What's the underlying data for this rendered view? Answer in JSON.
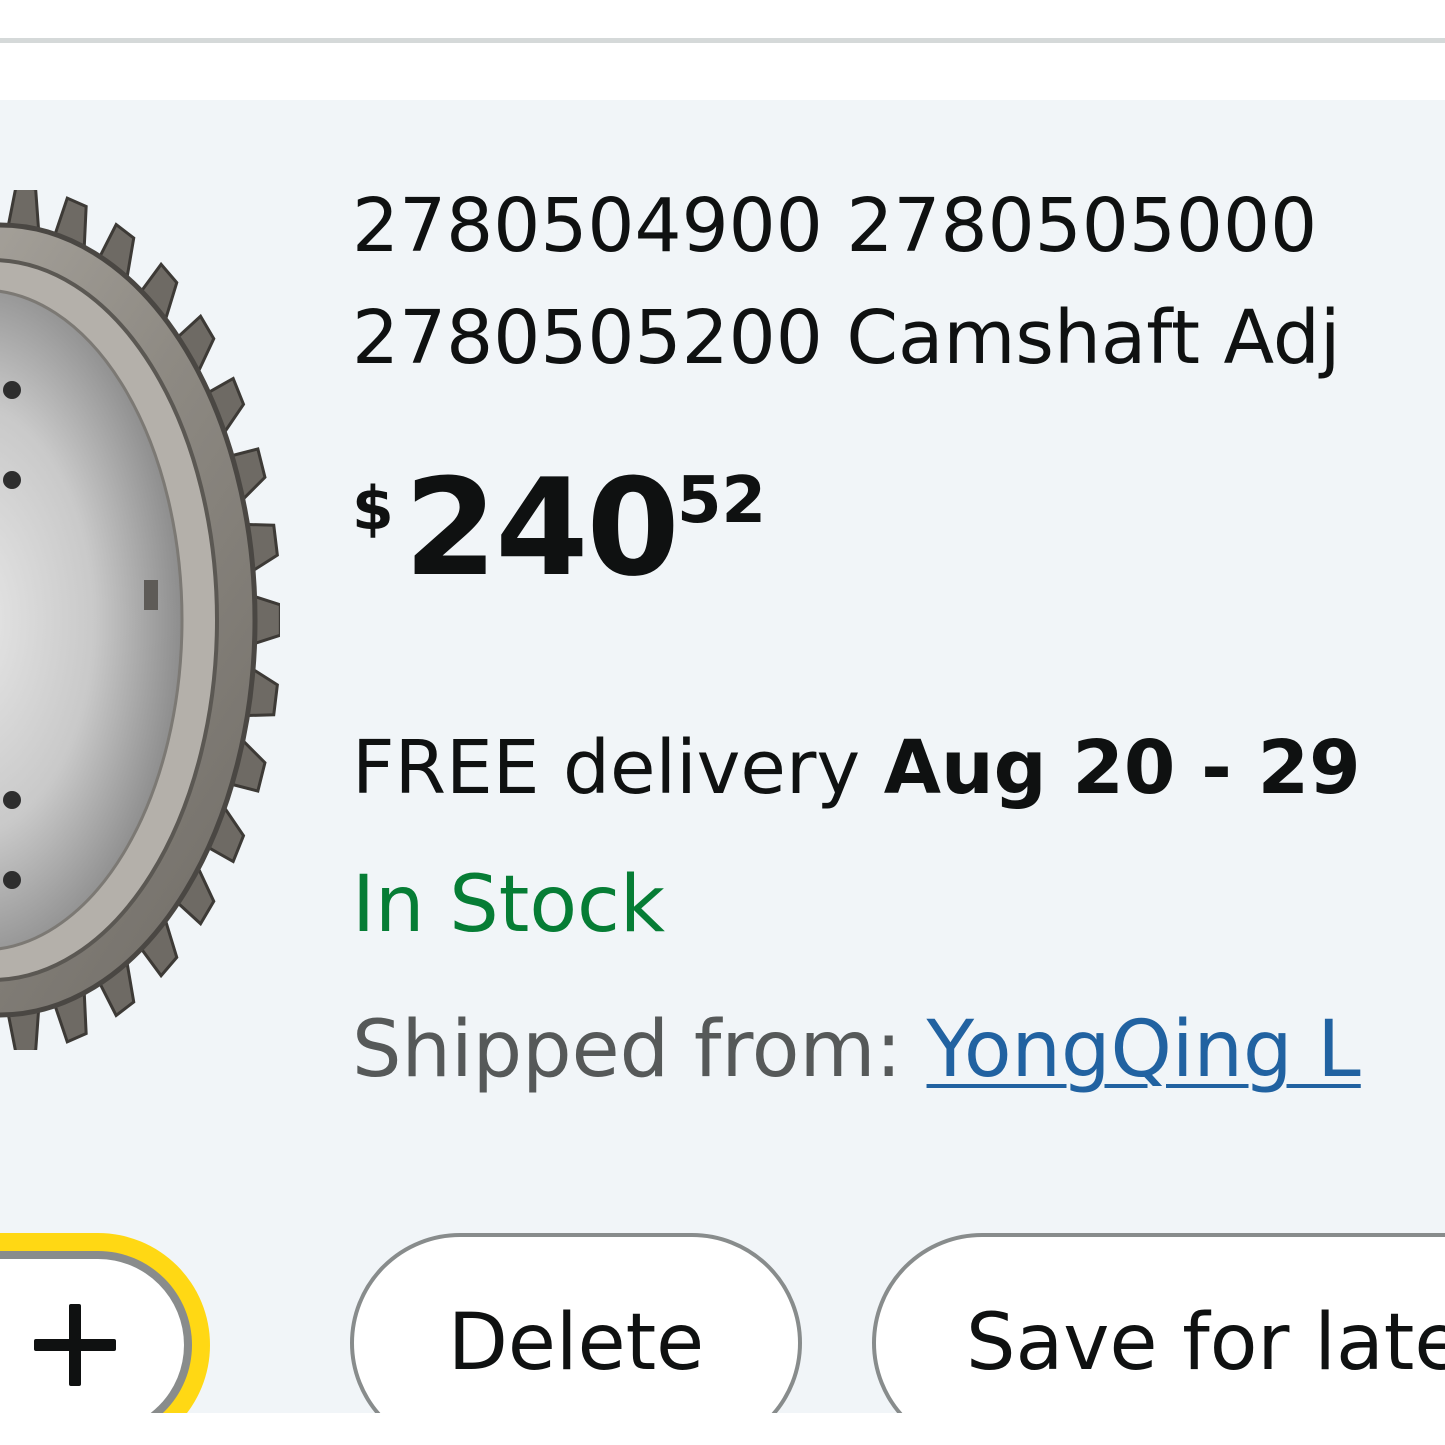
{
  "product": {
    "title_line1": "2780504900 2780505000",
    "title_line2": "2780505200 Camshaft Adj",
    "image_alt": "camshaft-adjuster-gear-image"
  },
  "price": {
    "symbol": "$",
    "whole": "240",
    "fraction": "52"
  },
  "delivery": {
    "prefix": "FREE delivery ",
    "dates": "Aug 20 - 29"
  },
  "availability": {
    "text": "In Stock",
    "color": "#067d35"
  },
  "shipping": {
    "label": "Shipped from: ",
    "seller": "YongQing L",
    "link_color": "#2162a1"
  },
  "actions": {
    "increment_icon": "plus-icon",
    "delete_label": "Delete",
    "save_label": "Save for late"
  },
  "colors": {
    "card_background": "#f1f5f8",
    "focus_ring": "#ffd814",
    "button_border": "#888c8c"
  }
}
